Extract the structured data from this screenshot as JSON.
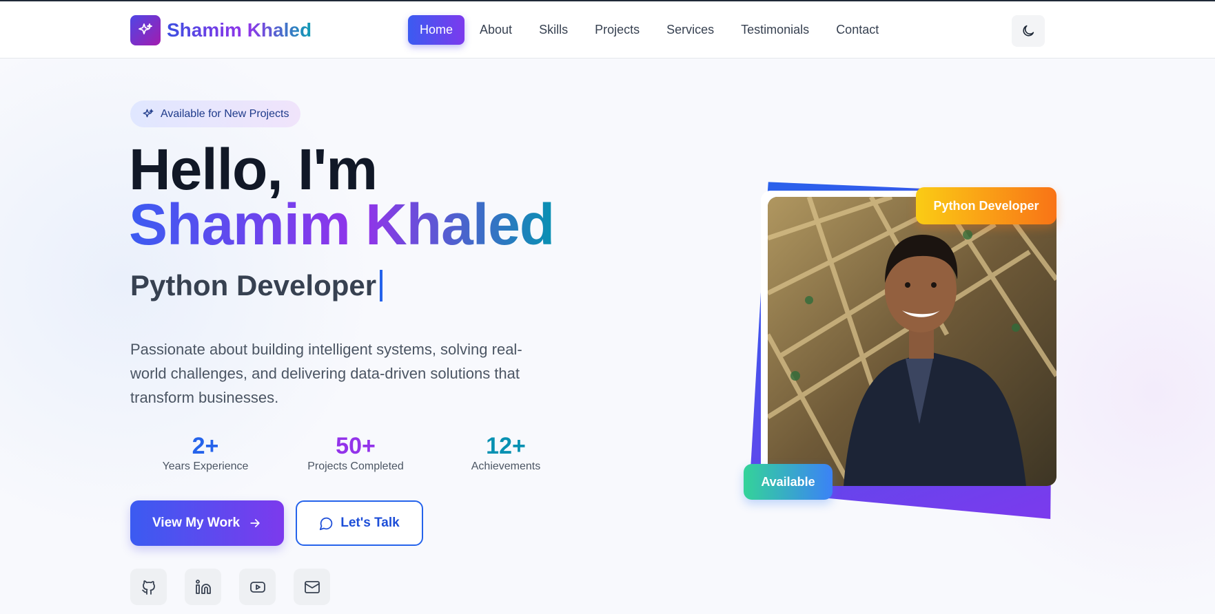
{
  "brand": {
    "name": "Shamim Khaled",
    "logo_icon": "sparkles-icon"
  },
  "nav": {
    "items": [
      {
        "label": "Home",
        "active": true
      },
      {
        "label": "About"
      },
      {
        "label": "Skills"
      },
      {
        "label": "Projects"
      },
      {
        "label": "Services"
      },
      {
        "label": "Testimonials"
      },
      {
        "label": "Contact"
      }
    ],
    "theme_icon": "moon-icon"
  },
  "hero": {
    "pill": "Available for New Projects",
    "greeting": "Hello, I'm",
    "name": "Shamim Khaled",
    "role": "Python Developer",
    "description": "Passionate about building intelligent systems, solving real-world challenges, and delivering data-driven solutions that transform businesses.",
    "stats": [
      {
        "value": "2+",
        "label": "Years Experience",
        "color": "#2563eb"
      },
      {
        "value": "50+",
        "label": "Projects Completed",
        "color": "#9333ea"
      },
      {
        "value": "12+",
        "label": "Achievements",
        "color": "#0891b2"
      }
    ],
    "primary_button": "View My Work",
    "secondary_button": "Let's Talk",
    "socials": [
      "github-icon",
      "linkedin-icon",
      "youtube-icon",
      "mail-icon"
    ]
  },
  "photo": {
    "badge_top": "Python Developer",
    "badge_bottom": "Available"
  },
  "colors": {
    "accent": "#3b5bf1",
    "accent_purple": "#7c3aed",
    "orange": "#f97316",
    "green": "#34d399"
  }
}
